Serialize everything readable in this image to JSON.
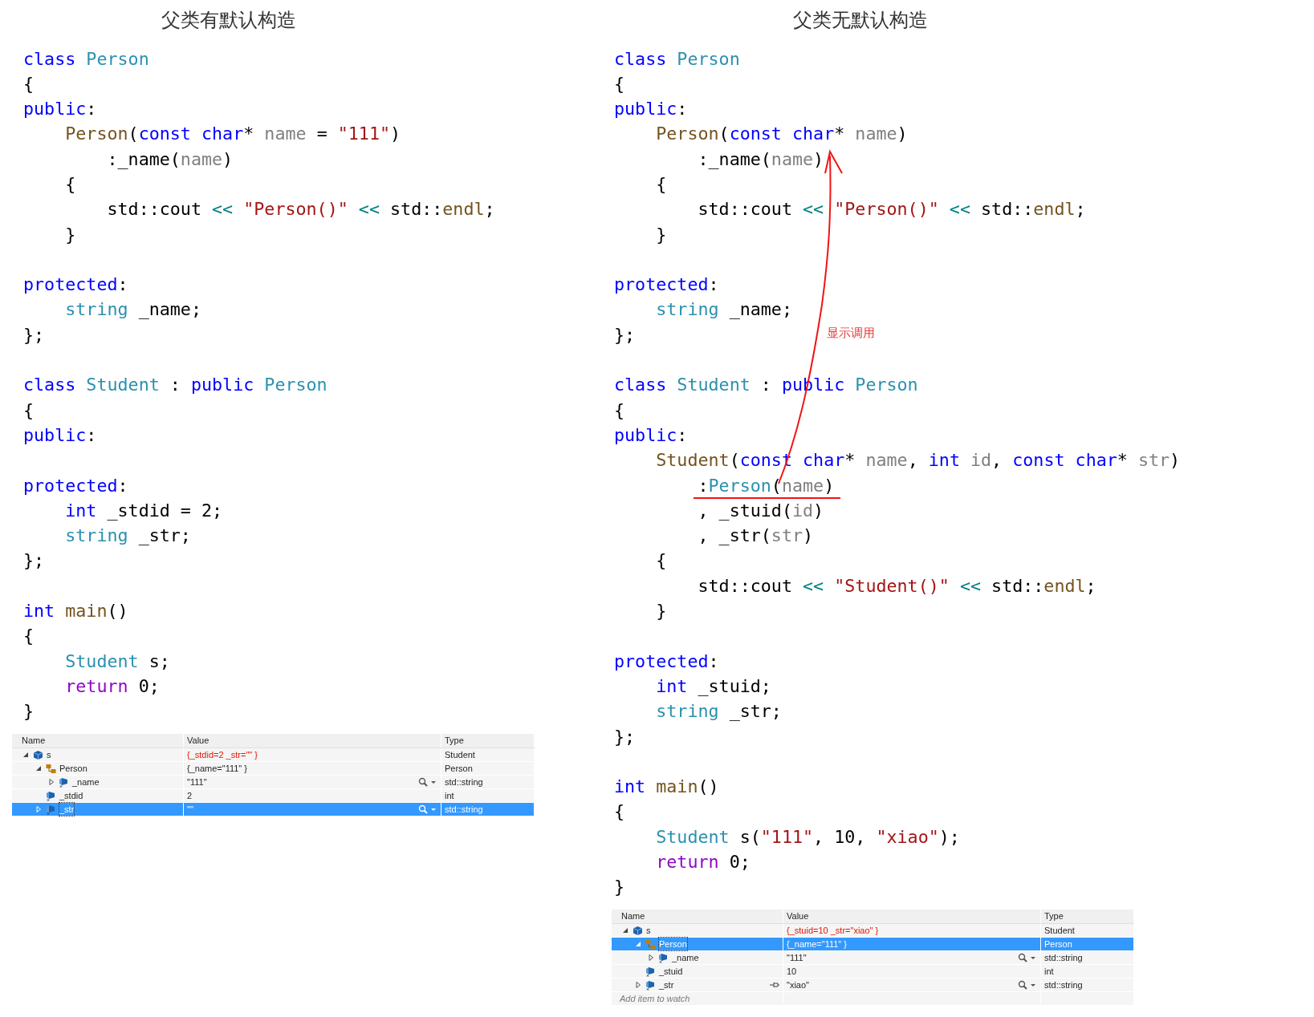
{
  "panels": [
    {
      "title": "父类有默认构造",
      "code": [
        {
          "kind": "code",
          "tokens": [
            {
              "kind": "keyword",
              "text": "class"
            },
            {
              "kind": "type",
              "text": " Person"
            }
          ]
        },
        {
          "kind": "code",
          "tokens": [
            {
              "kind": "text",
              "text": "{"
            }
          ]
        },
        {
          "kind": "code",
          "tokens": [
            {
              "kind": "keyword",
              "text": "public"
            },
            {
              "kind": "text",
              "text": ":"
            }
          ]
        },
        {
          "kind": "code",
          "tokens": [
            {
              "kind": "function",
              "text": "    Person"
            },
            {
              "kind": "text",
              "text": "("
            },
            {
              "kind": "keyword",
              "text": "const char"
            },
            {
              "kind": "text",
              "text": "* "
            },
            {
              "kind": "param",
              "text": "name"
            },
            {
              "kind": "text",
              "text": " = "
            },
            {
              "kind": "string",
              "text": "\"111\""
            },
            {
              "kind": "text",
              "text": ")"
            }
          ]
        },
        {
          "kind": "code",
          "tokens": [
            {
              "kind": "text",
              "text": "        :_name("
            },
            {
              "kind": "param",
              "text": "name"
            },
            {
              "kind": "text",
              "text": ")"
            }
          ]
        },
        {
          "kind": "code",
          "tokens": [
            {
              "kind": "text",
              "text": "    {"
            }
          ]
        },
        {
          "kind": "code",
          "tokens": [
            {
              "kind": "text",
              "text": "        std::cout "
            },
            {
              "kind": "operator",
              "text": "<<"
            },
            {
              "kind": "string",
              "text": " \"Person()\""
            },
            {
              "kind": "operator",
              "text": " <<"
            },
            {
              "kind": "text",
              "text": " std::"
            },
            {
              "kind": "function",
              "text": "endl"
            },
            {
              "kind": "text",
              "text": ";"
            }
          ]
        },
        {
          "kind": "code",
          "tokens": [
            {
              "kind": "text",
              "text": "    }"
            }
          ]
        },
        {
          "kind": "blank"
        },
        {
          "kind": "code",
          "tokens": [
            {
              "kind": "keyword",
              "text": "protected"
            },
            {
              "kind": "text",
              "text": ":"
            }
          ]
        },
        {
          "kind": "code",
          "tokens": [
            {
              "kind": "type",
              "text": "    string"
            },
            {
              "kind": "text",
              "text": " _name;"
            }
          ]
        },
        {
          "kind": "code",
          "tokens": [
            {
              "kind": "text",
              "text": "};"
            }
          ]
        },
        {
          "kind": "blank"
        },
        {
          "kind": "code",
          "tokens": [
            {
              "kind": "keyword",
              "text": "class"
            },
            {
              "kind": "type",
              "text": " Student"
            },
            {
              "kind": "text",
              "text": " : "
            },
            {
              "kind": "keyword",
              "text": "public"
            },
            {
              "kind": "type",
              "text": " Person"
            }
          ]
        },
        {
          "kind": "code",
          "tokens": [
            {
              "kind": "text",
              "text": "{"
            }
          ]
        },
        {
          "kind": "code",
          "tokens": [
            {
              "kind": "keyword",
              "text": "public"
            },
            {
              "kind": "text",
              "text": ":"
            }
          ]
        },
        {
          "kind": "blank"
        },
        {
          "kind": "code",
          "tokens": [
            {
              "kind": "keyword",
              "text": "protected"
            },
            {
              "kind": "text",
              "text": ":"
            }
          ]
        },
        {
          "kind": "code",
          "tokens": [
            {
              "kind": "keyword",
              "text": "    int"
            },
            {
              "kind": "text",
              "text": " _stdid = 2;"
            }
          ]
        },
        {
          "kind": "code",
          "tokens": [
            {
              "kind": "type",
              "text": "    string"
            },
            {
              "kind": "text",
              "text": " _str;"
            }
          ]
        },
        {
          "kind": "code",
          "tokens": [
            {
              "kind": "text",
              "text": "};"
            }
          ]
        },
        {
          "kind": "blank"
        },
        {
          "kind": "code",
          "tokens": [
            {
              "kind": "keyword",
              "text": "int"
            },
            {
              "kind": "function",
              "text": " main"
            },
            {
              "kind": "text",
              "text": "()"
            }
          ]
        },
        {
          "kind": "code",
          "tokens": [
            {
              "kind": "text",
              "text": "{"
            }
          ]
        },
        {
          "kind": "code",
          "tokens": [
            {
              "kind": "type",
              "text": "    Student"
            },
            {
              "kind": "text",
              "text": " s;"
            }
          ]
        },
        {
          "kind": "code",
          "tokens": [
            {
              "kind": "control",
              "text": "    return"
            },
            {
              "kind": "text",
              "text": " 0;"
            }
          ]
        },
        {
          "kind": "code",
          "tokens": [
            {
              "kind": "text",
              "text": "}"
            }
          ]
        }
      ],
      "watch": {
        "columns": [
          "Name",
          "Value",
          "Type"
        ],
        "rows": [
          {
            "kind": "object",
            "name": "s",
            "value": "{_stdid=2 _str=\"\" }",
            "type": "Student",
            "expandable": true,
            "expanded": true,
            "selected": false,
            "changed": true,
            "visualizer": false,
            "pinned": false,
            "children": [
              {
                "kind": "base",
                "name": "Person",
                "value": "{_name=\"111\" }",
                "type": "Person",
                "expandable": true,
                "expanded": true,
                "selected": false,
                "changed": false,
                "visualizer": false,
                "pinned": false,
                "children": [
                  {
                    "kind": "field",
                    "name": "_name",
                    "value": "\"111\"",
                    "type": "std::string",
                    "expandable": true,
                    "expanded": false,
                    "selected": false,
                    "changed": false,
                    "visualizer": true,
                    "pinned": false
                  }
                ]
              },
              {
                "kind": "field",
                "name": "_stdid",
                "value": "2",
                "type": "int",
                "expandable": false,
                "selected": false,
                "changed": false,
                "visualizer": false,
                "pinned": false
              },
              {
                "kind": "field",
                "name": "_str",
                "value": "\"\"",
                "type": "std::string",
                "expandable": true,
                "expanded": false,
                "selected": true,
                "changed": false,
                "visualizer": true,
                "pinned": false
              }
            ]
          }
        ]
      }
    },
    {
      "title": "父类无默认构造",
      "code": [
        {
          "kind": "code",
          "tokens": [
            {
              "kind": "keyword",
              "text": "class"
            },
            {
              "kind": "type",
              "text": " Person"
            }
          ]
        },
        {
          "kind": "code",
          "tokens": [
            {
              "kind": "text",
              "text": "{"
            }
          ]
        },
        {
          "kind": "code",
          "tokens": [
            {
              "kind": "keyword",
              "text": "public"
            },
            {
              "kind": "text",
              "text": ":"
            }
          ]
        },
        {
          "kind": "code",
          "tokens": [
            {
              "kind": "function",
              "text": "    Person"
            },
            {
              "kind": "text",
              "text": "("
            },
            {
              "kind": "keyword",
              "text": "const char"
            },
            {
              "kind": "text",
              "text": "* "
            },
            {
              "kind": "param",
              "text": "name"
            },
            {
              "kind": "text",
              "text": ")"
            }
          ]
        },
        {
          "kind": "code",
          "tokens": [
            {
              "kind": "text",
              "text": "        :_name("
            },
            {
              "kind": "param",
              "text": "name"
            },
            {
              "kind": "text",
              "text": ")"
            }
          ]
        },
        {
          "kind": "code",
          "tokens": [
            {
              "kind": "text",
              "text": "    {"
            }
          ]
        },
        {
          "kind": "code",
          "tokens": [
            {
              "kind": "text",
              "text": "        std::cout "
            },
            {
              "kind": "operator",
              "text": "<<"
            },
            {
              "kind": "string",
              "text": " \"Person()\""
            },
            {
              "kind": "operator",
              "text": " <<"
            },
            {
              "kind": "text",
              "text": " std::"
            },
            {
              "kind": "function",
              "text": "endl"
            },
            {
              "kind": "text",
              "text": ";"
            }
          ]
        },
        {
          "kind": "code",
          "tokens": [
            {
              "kind": "text",
              "text": "    }"
            }
          ]
        },
        {
          "kind": "blank"
        },
        {
          "kind": "code",
          "tokens": [
            {
              "kind": "keyword",
              "text": "protected"
            },
            {
              "kind": "text",
              "text": ":"
            }
          ]
        },
        {
          "kind": "code",
          "tokens": [
            {
              "kind": "type",
              "text": "    string"
            },
            {
              "kind": "text",
              "text": " _name;"
            }
          ]
        },
        {
          "kind": "code",
          "tokens": [
            {
              "kind": "text",
              "text": "};"
            }
          ]
        },
        {
          "kind": "blank"
        },
        {
          "kind": "code",
          "tokens": [
            {
              "kind": "keyword",
              "text": "class"
            },
            {
              "kind": "type",
              "text": " Student"
            },
            {
              "kind": "text",
              "text": " : "
            },
            {
              "kind": "keyword",
              "text": "public"
            },
            {
              "kind": "type",
              "text": " Person"
            }
          ]
        },
        {
          "kind": "code",
          "tokens": [
            {
              "kind": "text",
              "text": "{"
            }
          ]
        },
        {
          "kind": "code",
          "tokens": [
            {
              "kind": "keyword",
              "text": "public"
            },
            {
              "kind": "text",
              "text": ":"
            }
          ]
        },
        {
          "kind": "code",
          "tokens": [
            {
              "kind": "function",
              "text": "    Student"
            },
            {
              "kind": "text",
              "text": "("
            },
            {
              "kind": "keyword",
              "text": "const char"
            },
            {
              "kind": "text",
              "text": "* "
            },
            {
              "kind": "param",
              "text": "name"
            },
            {
              "kind": "text",
              "text": ", "
            },
            {
              "kind": "keyword",
              "text": "int"
            },
            {
              "kind": "param",
              "text": " id"
            },
            {
              "kind": "text",
              "text": ", "
            },
            {
              "kind": "keyword",
              "text": "const char"
            },
            {
              "kind": "text",
              "text": "* "
            },
            {
              "kind": "param",
              "text": "str"
            },
            {
              "kind": "text",
              "text": ")"
            }
          ]
        },
        {
          "kind": "code",
          "tokens": [
            {
              "kind": "text",
              "text": "        :"
            },
            {
              "kind": "type",
              "text": "Person"
            },
            {
              "kind": "text",
              "text": "("
            },
            {
              "kind": "param",
              "text": "name"
            },
            {
              "kind": "text",
              "text": ")"
            }
          ]
        },
        {
          "kind": "code",
          "tokens": [
            {
              "kind": "text",
              "text": "        , _stuid("
            },
            {
              "kind": "param",
              "text": "id"
            },
            {
              "kind": "text",
              "text": ")"
            }
          ]
        },
        {
          "kind": "code",
          "tokens": [
            {
              "kind": "text",
              "text": "        , _str("
            },
            {
              "kind": "param",
              "text": "str"
            },
            {
              "kind": "text",
              "text": ")"
            }
          ]
        },
        {
          "kind": "code",
          "tokens": [
            {
              "kind": "text",
              "text": "    {"
            }
          ]
        },
        {
          "kind": "code",
          "tokens": [
            {
              "kind": "text",
              "text": "        std::cout "
            },
            {
              "kind": "operator",
              "text": "<<"
            },
            {
              "kind": "string",
              "text": " \"Student()\""
            },
            {
              "kind": "operator",
              "text": " <<"
            },
            {
              "kind": "text",
              "text": " std::"
            },
            {
              "kind": "function",
              "text": "endl"
            },
            {
              "kind": "text",
              "text": ";"
            }
          ]
        },
        {
          "kind": "code",
          "tokens": [
            {
              "kind": "text",
              "text": "    }"
            }
          ]
        },
        {
          "kind": "blank"
        },
        {
          "kind": "code",
          "tokens": [
            {
              "kind": "keyword",
              "text": "protected"
            },
            {
              "kind": "text",
              "text": ":"
            }
          ]
        },
        {
          "kind": "code",
          "tokens": [
            {
              "kind": "keyword",
              "text": "    int"
            },
            {
              "kind": "text",
              "text": " _stuid;"
            }
          ]
        },
        {
          "kind": "code",
          "tokens": [
            {
              "kind": "type",
              "text": "    string"
            },
            {
              "kind": "text",
              "text": " _str;"
            }
          ]
        },
        {
          "kind": "code",
          "tokens": [
            {
              "kind": "text",
              "text": "};"
            }
          ]
        },
        {
          "kind": "blank"
        },
        {
          "kind": "code",
          "tokens": [
            {
              "kind": "keyword",
              "text": "int"
            },
            {
              "kind": "function",
              "text": " main"
            },
            {
              "kind": "text",
              "text": "()"
            }
          ]
        },
        {
          "kind": "code",
          "tokens": [
            {
              "kind": "text",
              "text": "{"
            }
          ]
        },
        {
          "kind": "code",
          "tokens": [
            {
              "kind": "type",
              "text": "    Student"
            },
            {
              "kind": "text",
              "text": " s("
            },
            {
              "kind": "string",
              "text": "\"111\""
            },
            {
              "kind": "text",
              "text": ", 10, "
            },
            {
              "kind": "string",
              "text": "\"xiao\""
            },
            {
              "kind": "text",
              "text": ");"
            }
          ]
        },
        {
          "kind": "code",
          "tokens": [
            {
              "kind": "control",
              "text": "    return"
            },
            {
              "kind": "text",
              "text": " 0;"
            }
          ]
        },
        {
          "kind": "code",
          "tokens": [
            {
              "kind": "text",
              "text": "}"
            }
          ]
        }
      ],
      "annotation": {
        "label": "显示调用"
      },
      "watch": {
        "columns": [
          "Name",
          "Value",
          "Type"
        ],
        "rows": [
          {
            "kind": "object",
            "name": "s",
            "value": "{_stuid=10 _str=\"xiao\" }",
            "type": "Student",
            "expandable": true,
            "expanded": true,
            "selected": false,
            "changed": true,
            "visualizer": false,
            "pinned": false,
            "children": [
              {
                "kind": "base",
                "name": "Person",
                "value": "{_name=\"111\" }",
                "type": "Person",
                "expandable": true,
                "expanded": true,
                "selected": true,
                "changed": false,
                "visualizer": false,
                "pinned": false,
                "children": [
                  {
                    "kind": "field",
                    "name": "_name",
                    "value": "\"111\"",
                    "type": "std::string",
                    "expandable": true,
                    "expanded": false,
                    "selected": false,
                    "changed": false,
                    "visualizer": true,
                    "pinned": false
                  }
                ]
              },
              {
                "kind": "field",
                "name": "_stuid",
                "value": "10",
                "type": "int",
                "expandable": false,
                "selected": false,
                "changed": false,
                "visualizer": false,
                "pinned": false
              },
              {
                "kind": "field",
                "name": "_str",
                "value": "\"xiao\"",
                "type": "std::string",
                "expandable": true,
                "expanded": false,
                "selected": false,
                "changed": false,
                "visualizer": true,
                "pinned": true
              }
            ]
          }
        ],
        "add_prompt": "Add item to watch"
      }
    }
  ]
}
